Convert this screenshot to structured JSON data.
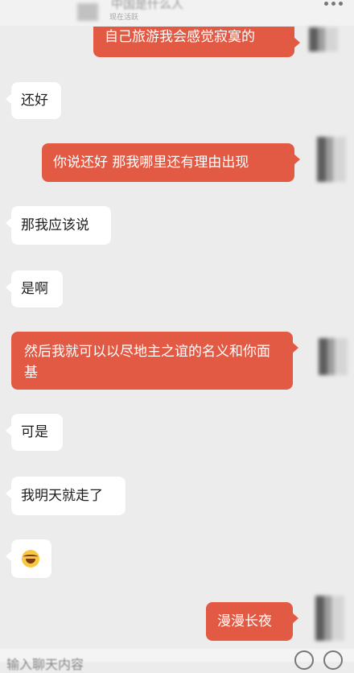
{
  "header": {
    "title": "中国是什么人",
    "status": "现在活跃"
  },
  "messages": [
    {
      "side": "out",
      "text": "自己旅游我会感觉寂寞的"
    },
    {
      "side": "in",
      "text": "还好"
    },
    {
      "side": "out",
      "text": "你说还好 那我哪里还有理由出现"
    },
    {
      "side": "in",
      "text": "那我应该说"
    },
    {
      "side": "in",
      "text": "是啊"
    },
    {
      "side": "out",
      "text": "然后我就可以以尽地主之谊的名义和你面基"
    },
    {
      "side": "in",
      "text": "可是"
    },
    {
      "side": "in",
      "text": "我明天就走了"
    },
    {
      "side": "in",
      "emoji": "laughing-crying-emoji"
    },
    {
      "side": "out",
      "text": "漫漫长夜"
    }
  ],
  "input": {
    "placeholder": "输入聊天内容"
  },
  "colors": {
    "background": "#ececec",
    "incoming_bubble": "#ffffff",
    "outgoing_bubble": "#e35a44"
  }
}
